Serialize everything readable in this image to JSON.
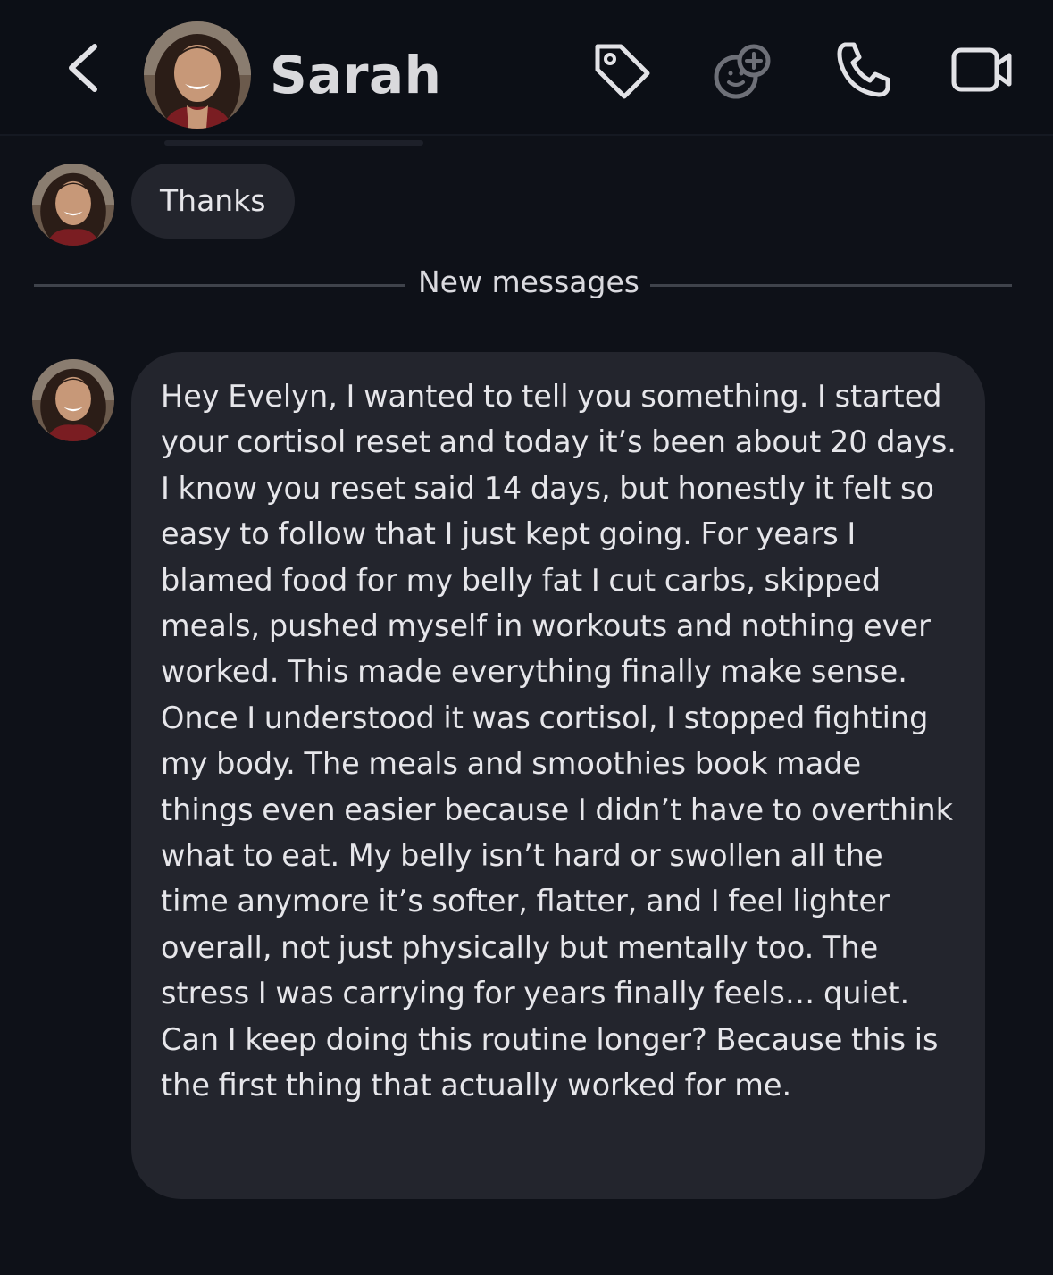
{
  "header": {
    "contact_name": "Sarah",
    "icons": [
      "back-icon",
      "tag-icon",
      "effects-icon",
      "phone-icon",
      "video-icon"
    ]
  },
  "messages": [
    {
      "sender": "Sarah",
      "text": "Thanks"
    },
    {
      "sender": "Sarah",
      "text": "Hey Evelyn, I wanted to tell you something. I started your cortisol reset and today it’s been about 20 days. I know you reset said 14 days, but honestly it felt so easy to follow that I just kept going. For years I blamed food for my belly fat I cut carbs, skipped meals, pushed myself in workouts and nothing ever worked. This made everything finally make sense. Once I understood it was cortisol, I stopped fighting my body. The meals and smoothies book made things even easier because I didn’t have to overthink what to eat. My belly isn’t hard or swollen all the time anymore it’s softer, flatter, and I feel lighter overall, not just physically but mentally too. The stress I was carrying for years finally feels… quiet. Can I keep doing this routine longer? Because this is the first thing that actually worked for me."
    }
  ],
  "divider": {
    "label": "New messages"
  },
  "colors": {
    "background": "#0e1118",
    "header": "#0c0f16",
    "bubble": "#23252d",
    "text": "#e6e6ea",
    "icon": "#e2e2e6",
    "icon_disabled": "#6e7078"
  }
}
